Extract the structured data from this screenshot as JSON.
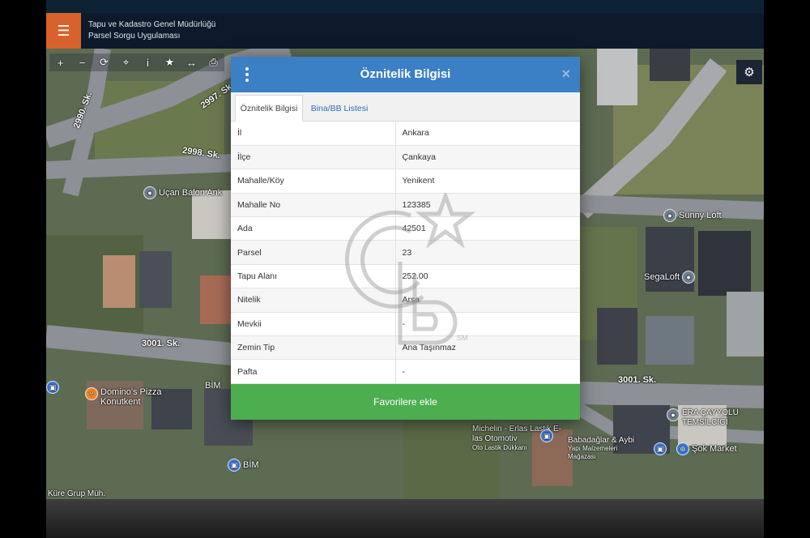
{
  "header": {
    "title_line1": "Tapu ve Kadastro Genel Müdürlüğü",
    "title_line2": "Parsel Sorgu Uygulaması",
    "menu_icon": "☰"
  },
  "map": {
    "street_labels": [
      "2997. Sk.",
      "2990. Sk.",
      "2998. Sk.",
      "3001. Sk.",
      "3001. Sk."
    ],
    "pois": {
      "ucan_balon": "Uçan Balon Ank",
      "sunny_loft": "Sunny Loft",
      "sega_loft": "SegaLoft",
      "dominos": "Domino's Pizza Konutkent",
      "bim1": "BİM",
      "bim2": "BİM",
      "michelin": "Michelin - Erlas Lastik E-las Otomotiv",
      "michelin_sub": "Oto Lastik Dükkanı",
      "babadaglar": "Babadağlar & Aybi",
      "babadaglar_sub": "Yapı Malzemeleri Mağazası",
      "era": "ERA ÇAYYOLU TEMSİLCİĞİ",
      "sok": "Şok Market",
      "kure": "Küre Grup Müh."
    },
    "toolbar_icons": [
      "plus-icon",
      "minus-icon",
      "refresh-icon",
      "locate-icon",
      "info-icon",
      "star-icon",
      "measure-icon",
      "print-icon"
    ],
    "toolbar_glyphs": [
      "+",
      "−",
      "⟳",
      "⌖",
      "i",
      "★",
      "↔",
      "⎙"
    ],
    "gear_glyph": "⚙"
  },
  "dialog": {
    "title": "Öznitelik Bilgisi",
    "close_glyph": "×",
    "tabs": [
      {
        "label": "Öznitelik Bilgisi",
        "active": true
      },
      {
        "label": "Bina/BB Listesi",
        "active": false
      }
    ],
    "rows": [
      {
        "key": "İl",
        "value": "Ankara"
      },
      {
        "key": "İlçe",
        "value": "Çankaya"
      },
      {
        "key": "Mahalle/Köy",
        "value": "Yenikent"
      },
      {
        "key": "Mahalle No",
        "value": "123385"
      },
      {
        "key": "Ada",
        "value": "42501"
      },
      {
        "key": "Parsel",
        "value": "23"
      },
      {
        "key": "Tapu Alanı",
        "value": "252.00"
      },
      {
        "key": "Nitelik",
        "value": "Arsa"
      },
      {
        "key": "Mevkii",
        "value": "-"
      },
      {
        "key": "Zemin Tip",
        "value": "Ana Taşınmaz"
      },
      {
        "key": "Pafta",
        "value": "-"
      }
    ],
    "favorite_label": "Favorilere ekle"
  },
  "watermark": {
    "mark": "SM"
  },
  "colors": {
    "header_bg": "#0c1a2c",
    "menu_orange": "#d8622c",
    "dialog_blue": "#3b7fc4",
    "favorite_green": "#4cae4f",
    "tab_link": "#2e6fb5"
  }
}
